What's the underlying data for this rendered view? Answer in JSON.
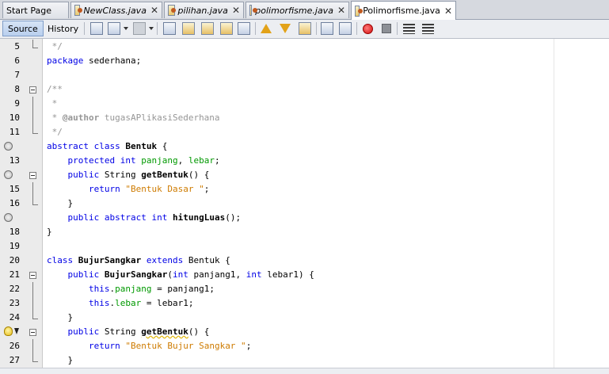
{
  "tabs": [
    {
      "label": "Start Page",
      "italic": false,
      "closable": false,
      "active": false
    },
    {
      "label": "NewClass.java",
      "italic": true,
      "closable": true,
      "active": false
    },
    {
      "label": "pilihan.java",
      "italic": true,
      "closable": true,
      "active": false
    },
    {
      "label": "polimorfisme.java",
      "italic": true,
      "closable": true,
      "active": false
    },
    {
      "label": "Polimorfisme.java",
      "italic": false,
      "closable": true,
      "active": true
    }
  ],
  "tab_close_glyph": "✕",
  "toolbar": {
    "source_label": "Source",
    "history_label": "History",
    "icons": [
      "last-edit-icon",
      "back-icon",
      "forward-icon",
      "find-icon",
      "find-previous-icon",
      "find-next-icon",
      "toggle-highlight-icon",
      "toggle-rectangular-selection-icon",
      "previous-bookmark-icon",
      "next-bookmark-icon",
      "toggle-bookmark-icon",
      "shift-left-icon",
      "shift-right-icon",
      "start-macro-recording-icon",
      "stop-macro-recording-icon",
      "comment-icon",
      "uncomment-icon"
    ]
  },
  "colors": {
    "keyword": "#0000e6",
    "field": "#009900",
    "string": "#ce7b00",
    "comment": "#969696",
    "gutter_bg": "#ebebeb"
  },
  "lines": [
    {
      "num": "5",
      "gutter": "",
      "fold": "end",
      "tokens": [
        {
          "t": " */",
          "c": "cm"
        }
      ]
    },
    {
      "num": "6",
      "gutter": "",
      "fold": "",
      "tokens": [
        {
          "t": "package",
          "c": "kw"
        },
        {
          "t": " sederhana;",
          "c": ""
        }
      ]
    },
    {
      "num": "7",
      "gutter": "",
      "fold": "",
      "tokens": []
    },
    {
      "num": "8",
      "gutter": "",
      "fold": "start",
      "tokens": [
        {
          "t": "/**",
          "c": "cm"
        }
      ]
    },
    {
      "num": "9",
      "gutter": "",
      "fold": "mid",
      "tokens": [
        {
          "t": " *",
          "c": "cm"
        }
      ]
    },
    {
      "num": "10",
      "gutter": "",
      "fold": "mid",
      "tokens": [
        {
          "t": " * ",
          "c": "cm"
        },
        {
          "t": "@author",
          "c": "cm bd"
        },
        {
          "t": " tugasAPlikasiSederhana",
          "c": "cm"
        }
      ]
    },
    {
      "num": "11",
      "gutter": "",
      "fold": "end",
      "tokens": [
        {
          "t": " */",
          "c": "cm"
        }
      ]
    },
    {
      "num": "",
      "gutter": "annotation",
      "fold": "",
      "tokens": [
        {
          "t": "abstract",
          "c": "kw"
        },
        {
          "t": " ",
          "c": ""
        },
        {
          "t": "class",
          "c": "kw"
        },
        {
          "t": " ",
          "c": ""
        },
        {
          "t": "Bentuk",
          "c": "bd"
        },
        {
          "t": " {",
          "c": ""
        }
      ]
    },
    {
      "num": "13",
      "gutter": "",
      "fold": "",
      "tokens": [
        {
          "t": "    ",
          "c": ""
        },
        {
          "t": "protected",
          "c": "kw"
        },
        {
          "t": " ",
          "c": ""
        },
        {
          "t": "int",
          "c": "kw"
        },
        {
          "t": " ",
          "c": ""
        },
        {
          "t": "panjang",
          "c": "fd"
        },
        {
          "t": ", ",
          "c": ""
        },
        {
          "t": "lebar",
          "c": "fd"
        },
        {
          "t": ";",
          "c": ""
        }
      ]
    },
    {
      "num": "",
      "gutter": "annotation",
      "fold": "start",
      "tokens": [
        {
          "t": "    ",
          "c": ""
        },
        {
          "t": "public",
          "c": "kw"
        },
        {
          "t": " String ",
          "c": ""
        },
        {
          "t": "getBentuk",
          "c": "bd"
        },
        {
          "t": "() {",
          "c": ""
        }
      ]
    },
    {
      "num": "15",
      "gutter": "",
      "fold": "mid",
      "tokens": [
        {
          "t": "        ",
          "c": ""
        },
        {
          "t": "return",
          "c": "kw"
        },
        {
          "t": " ",
          "c": ""
        },
        {
          "t": "\"Bentuk Dasar \"",
          "c": "st"
        },
        {
          "t": ";",
          "c": ""
        }
      ]
    },
    {
      "num": "16",
      "gutter": "",
      "fold": "end",
      "tokens": [
        {
          "t": "    }",
          "c": ""
        }
      ]
    },
    {
      "num": "",
      "gutter": "annotation",
      "fold": "",
      "tokens": [
        {
          "t": "    ",
          "c": ""
        },
        {
          "t": "public",
          "c": "kw"
        },
        {
          "t": " ",
          "c": ""
        },
        {
          "t": "abstract",
          "c": "kw"
        },
        {
          "t": " ",
          "c": ""
        },
        {
          "t": "int",
          "c": "kw"
        },
        {
          "t": " ",
          "c": ""
        },
        {
          "t": "hitungLuas",
          "c": "bd"
        },
        {
          "t": "();",
          "c": ""
        }
      ]
    },
    {
      "num": "18",
      "gutter": "",
      "fold": "",
      "tokens": [
        {
          "t": "}",
          "c": ""
        }
      ]
    },
    {
      "num": "19",
      "gutter": "",
      "fold": "",
      "tokens": []
    },
    {
      "num": "20",
      "gutter": "",
      "fold": "",
      "tokens": [
        {
          "t": "class",
          "c": "kw"
        },
        {
          "t": " ",
          "c": ""
        },
        {
          "t": "BujurSangkar",
          "c": "bd"
        },
        {
          "t": " ",
          "c": ""
        },
        {
          "t": "extends",
          "c": "kw"
        },
        {
          "t": " Bentuk {",
          "c": ""
        }
      ]
    },
    {
      "num": "21",
      "gutter": "",
      "fold": "start",
      "tokens": [
        {
          "t": "    ",
          "c": ""
        },
        {
          "t": "public",
          "c": "kw"
        },
        {
          "t": " ",
          "c": ""
        },
        {
          "t": "BujurSangkar",
          "c": "bd"
        },
        {
          "t": "(",
          "c": ""
        },
        {
          "t": "int",
          "c": "kw"
        },
        {
          "t": " panjang1, ",
          "c": ""
        },
        {
          "t": "int",
          "c": "kw"
        },
        {
          "t": " lebar1) {",
          "c": ""
        }
      ]
    },
    {
      "num": "22",
      "gutter": "",
      "fold": "mid",
      "tokens": [
        {
          "t": "        ",
          "c": ""
        },
        {
          "t": "this",
          "c": "kw"
        },
        {
          "t": ".",
          "c": ""
        },
        {
          "t": "panjang",
          "c": "fd"
        },
        {
          "t": " = panjang1;",
          "c": ""
        }
      ]
    },
    {
      "num": "23",
      "gutter": "",
      "fold": "mid",
      "tokens": [
        {
          "t": "        ",
          "c": ""
        },
        {
          "t": "this",
          "c": "kw"
        },
        {
          "t": ".",
          "c": ""
        },
        {
          "t": "lebar",
          "c": "fd"
        },
        {
          "t": " = lebar1;",
          "c": ""
        }
      ]
    },
    {
      "num": "24",
      "gutter": "",
      "fold": "end",
      "tokens": [
        {
          "t": "    }",
          "c": ""
        }
      ]
    },
    {
      "num": "",
      "gutter": "hint",
      "fold": "start",
      "tokens": [
        {
          "t": "    ",
          "c": ""
        },
        {
          "t": "public",
          "c": "kw"
        },
        {
          "t": " String ",
          "c": ""
        },
        {
          "t": "getBentuk",
          "c": "bd wv"
        },
        {
          "t": "() {",
          "c": ""
        }
      ]
    },
    {
      "num": "26",
      "gutter": "",
      "fold": "mid",
      "tokens": [
        {
          "t": "        ",
          "c": ""
        },
        {
          "t": "return",
          "c": "kw"
        },
        {
          "t": " ",
          "c": ""
        },
        {
          "t": "\"Bentuk Bujur Sangkar \"",
          "c": "st"
        },
        {
          "t": ";",
          "c": ""
        }
      ]
    },
    {
      "num": "27",
      "gutter": "",
      "fold": "end",
      "tokens": [
        {
          "t": "    }",
          "c": ""
        }
      ]
    }
  ]
}
